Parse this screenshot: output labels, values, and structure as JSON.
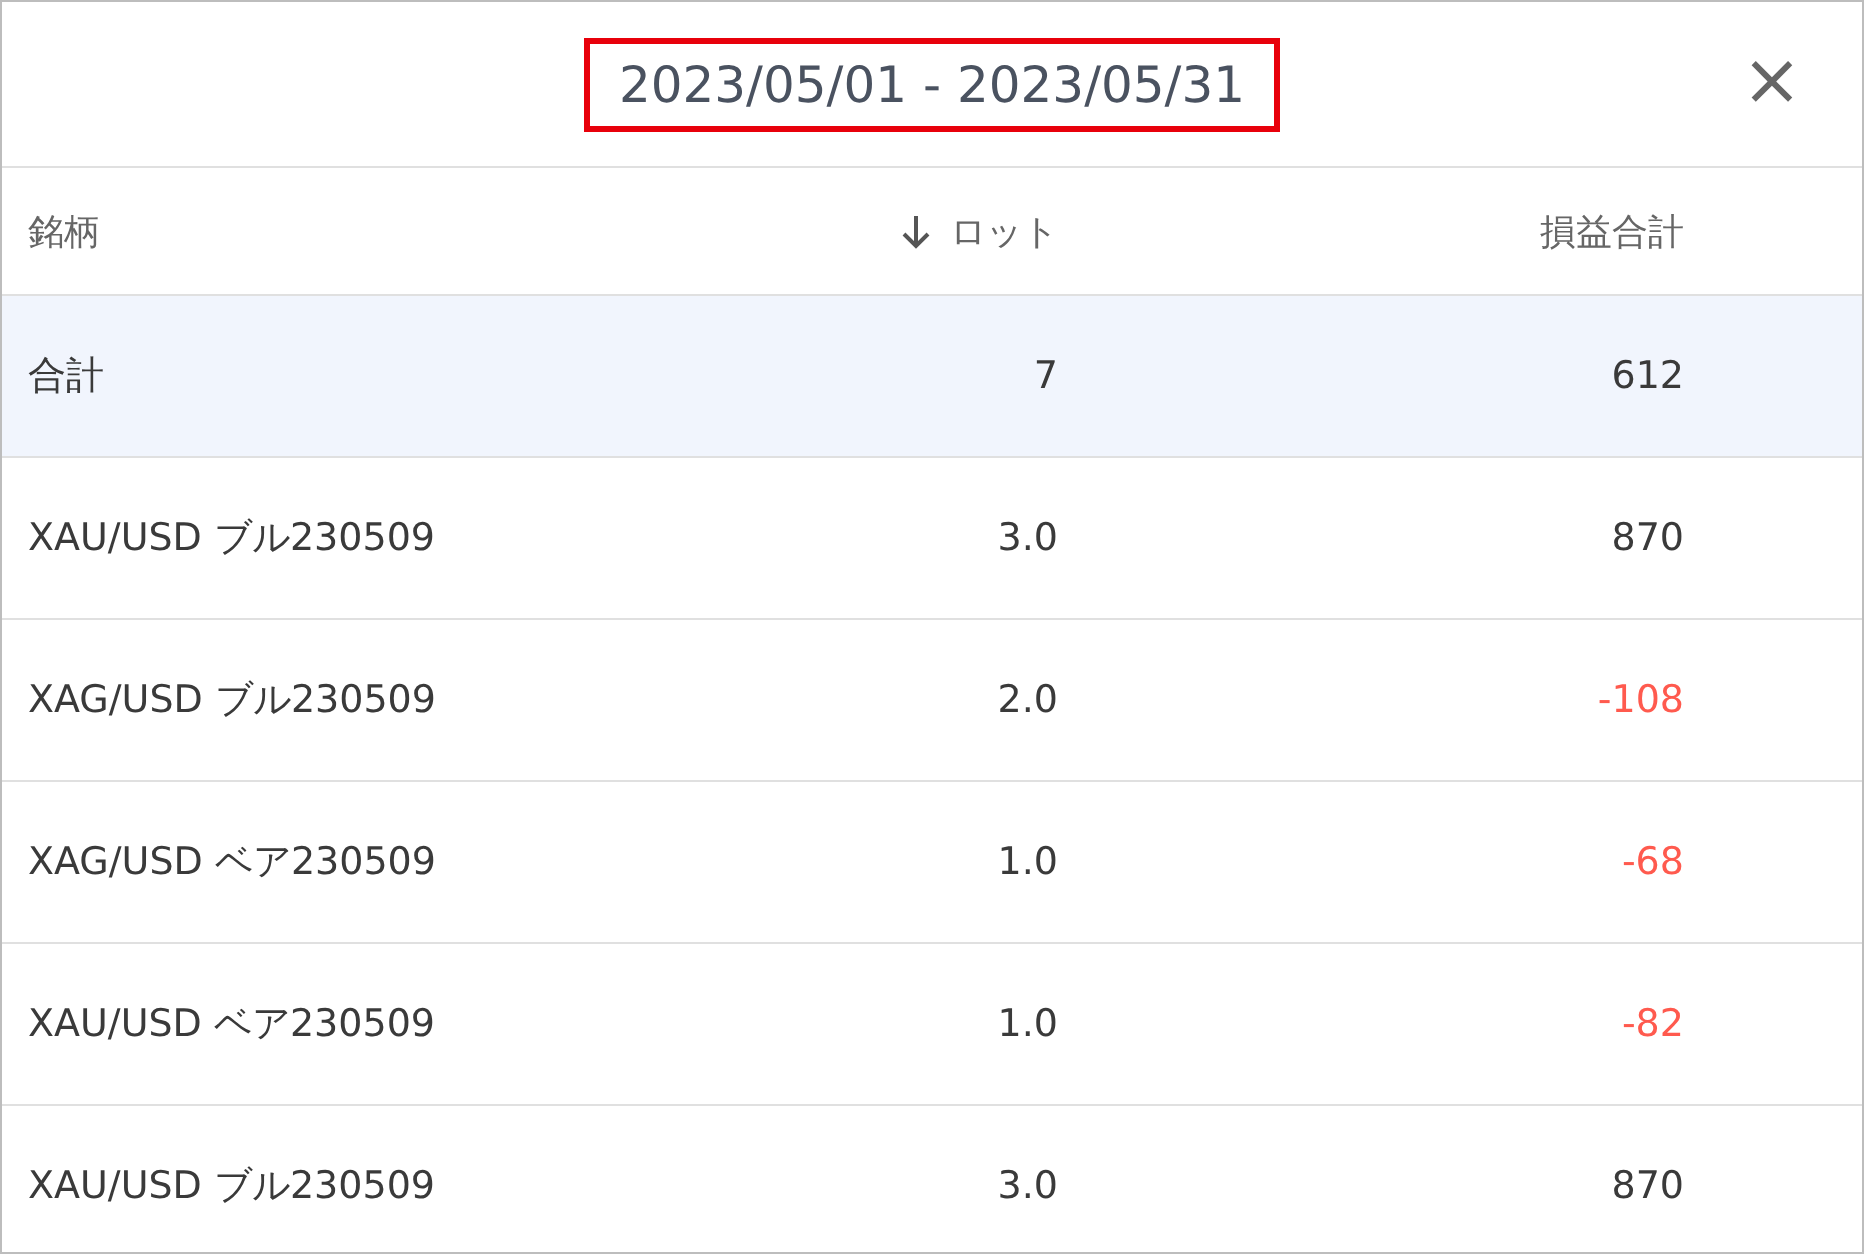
{
  "dialog": {
    "title": "2023/05/01 - 2023/05/31",
    "title_highlighted": true,
    "close": "×"
  },
  "table": {
    "columns": [
      {
        "label": "銘柄",
        "sorted": false
      },
      {
        "label": "ロット",
        "sorted": true
      },
      {
        "label": "損益合計",
        "sorted": false
      }
    ],
    "rows": [
      {
        "name": "合計",
        "lot": "7",
        "pnl": "612",
        "negative": false,
        "highlighted": true
      },
      {
        "name": "XAU/USD ブル230509",
        "lot": "3.0",
        "pnl": "870",
        "negative": false,
        "highlighted": false
      },
      {
        "name": "XAG/USD ブル230509",
        "lot": "2.0",
        "pnl": "-108",
        "negative": true,
        "highlighted": false
      },
      {
        "name": "XAG/USD ベア230509",
        "lot": "1.0",
        "pnl": "-68",
        "negative": true,
        "highlighted": false
      },
      {
        "name": "XAU/USD ベア230509",
        "lot": "1.0",
        "pnl": "-82",
        "negative": true,
        "highlighted": false
      },
      {
        "name": "XAU/USD ブル230509",
        "lot": "3.0",
        "pnl": "870",
        "negative": false,
        "highlighted": false
      }
    ]
  }
}
